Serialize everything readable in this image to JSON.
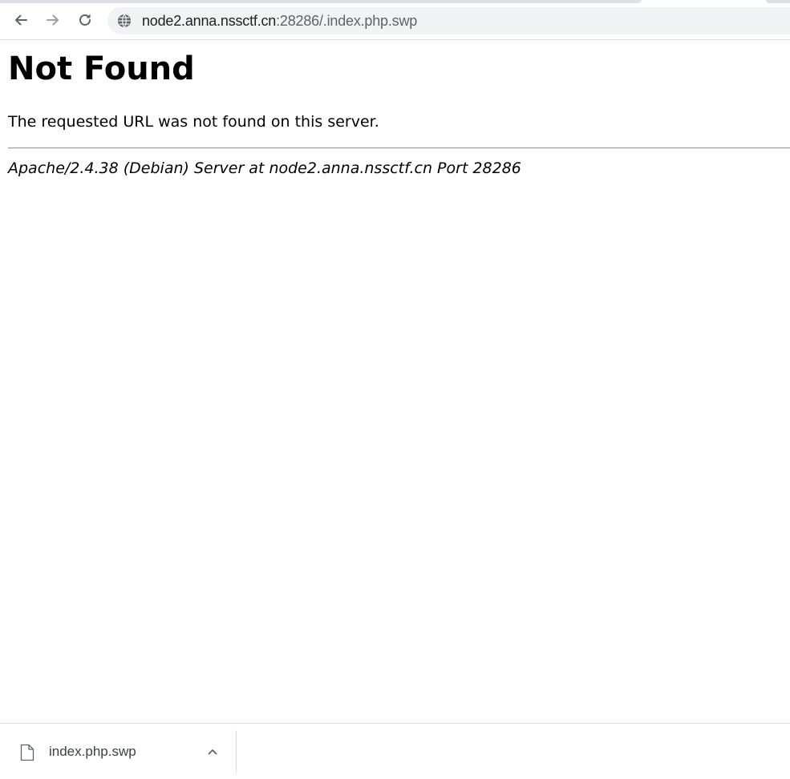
{
  "browser": {
    "address_bar": {
      "host": "node2.anna.nssctf.cn",
      "rest": ":28286/.index.php.swp"
    },
    "icons": {
      "back": "arrow-left-icon",
      "forward": "arrow-right-icon",
      "reload": "reload-icon",
      "site_info": "globe-icon"
    },
    "colors": {
      "toolbar_bg": "#ffffff",
      "omnibox_bg": "#f1f3f4",
      "icon_active": "#5f6368",
      "icon_disabled": "#9aa0a6"
    }
  },
  "page": {
    "title": "Not Found",
    "message": "The requested URL was not found on this server.",
    "signature": "Apache/2.4.38 (Debian) Server at node2.anna.nssctf.cn Port 28286"
  },
  "downloads": {
    "items": [
      {
        "filename": "index.php.swp",
        "icon": "file-icon",
        "menu_icon": "chevron-up-icon"
      }
    ]
  }
}
